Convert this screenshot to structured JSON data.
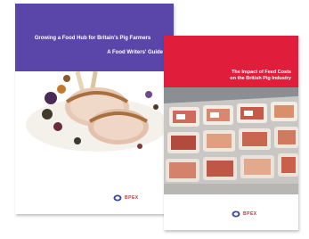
{
  "front_cover": {
    "tag": "",
    "title": "Growing a Food Hub for Britain's Pig Farmers",
    "subtitle": "A Food Writers' Guide",
    "band_color": "#5a45a8",
    "logo_text": "BPEX"
  },
  "back_cover": {
    "tag": "",
    "title_line_1": "The Impact of Feed Costs",
    "title_line_2": "on the British Pig Industry",
    "band_color": "#e01e3c",
    "logo_text": "BPEX"
  }
}
